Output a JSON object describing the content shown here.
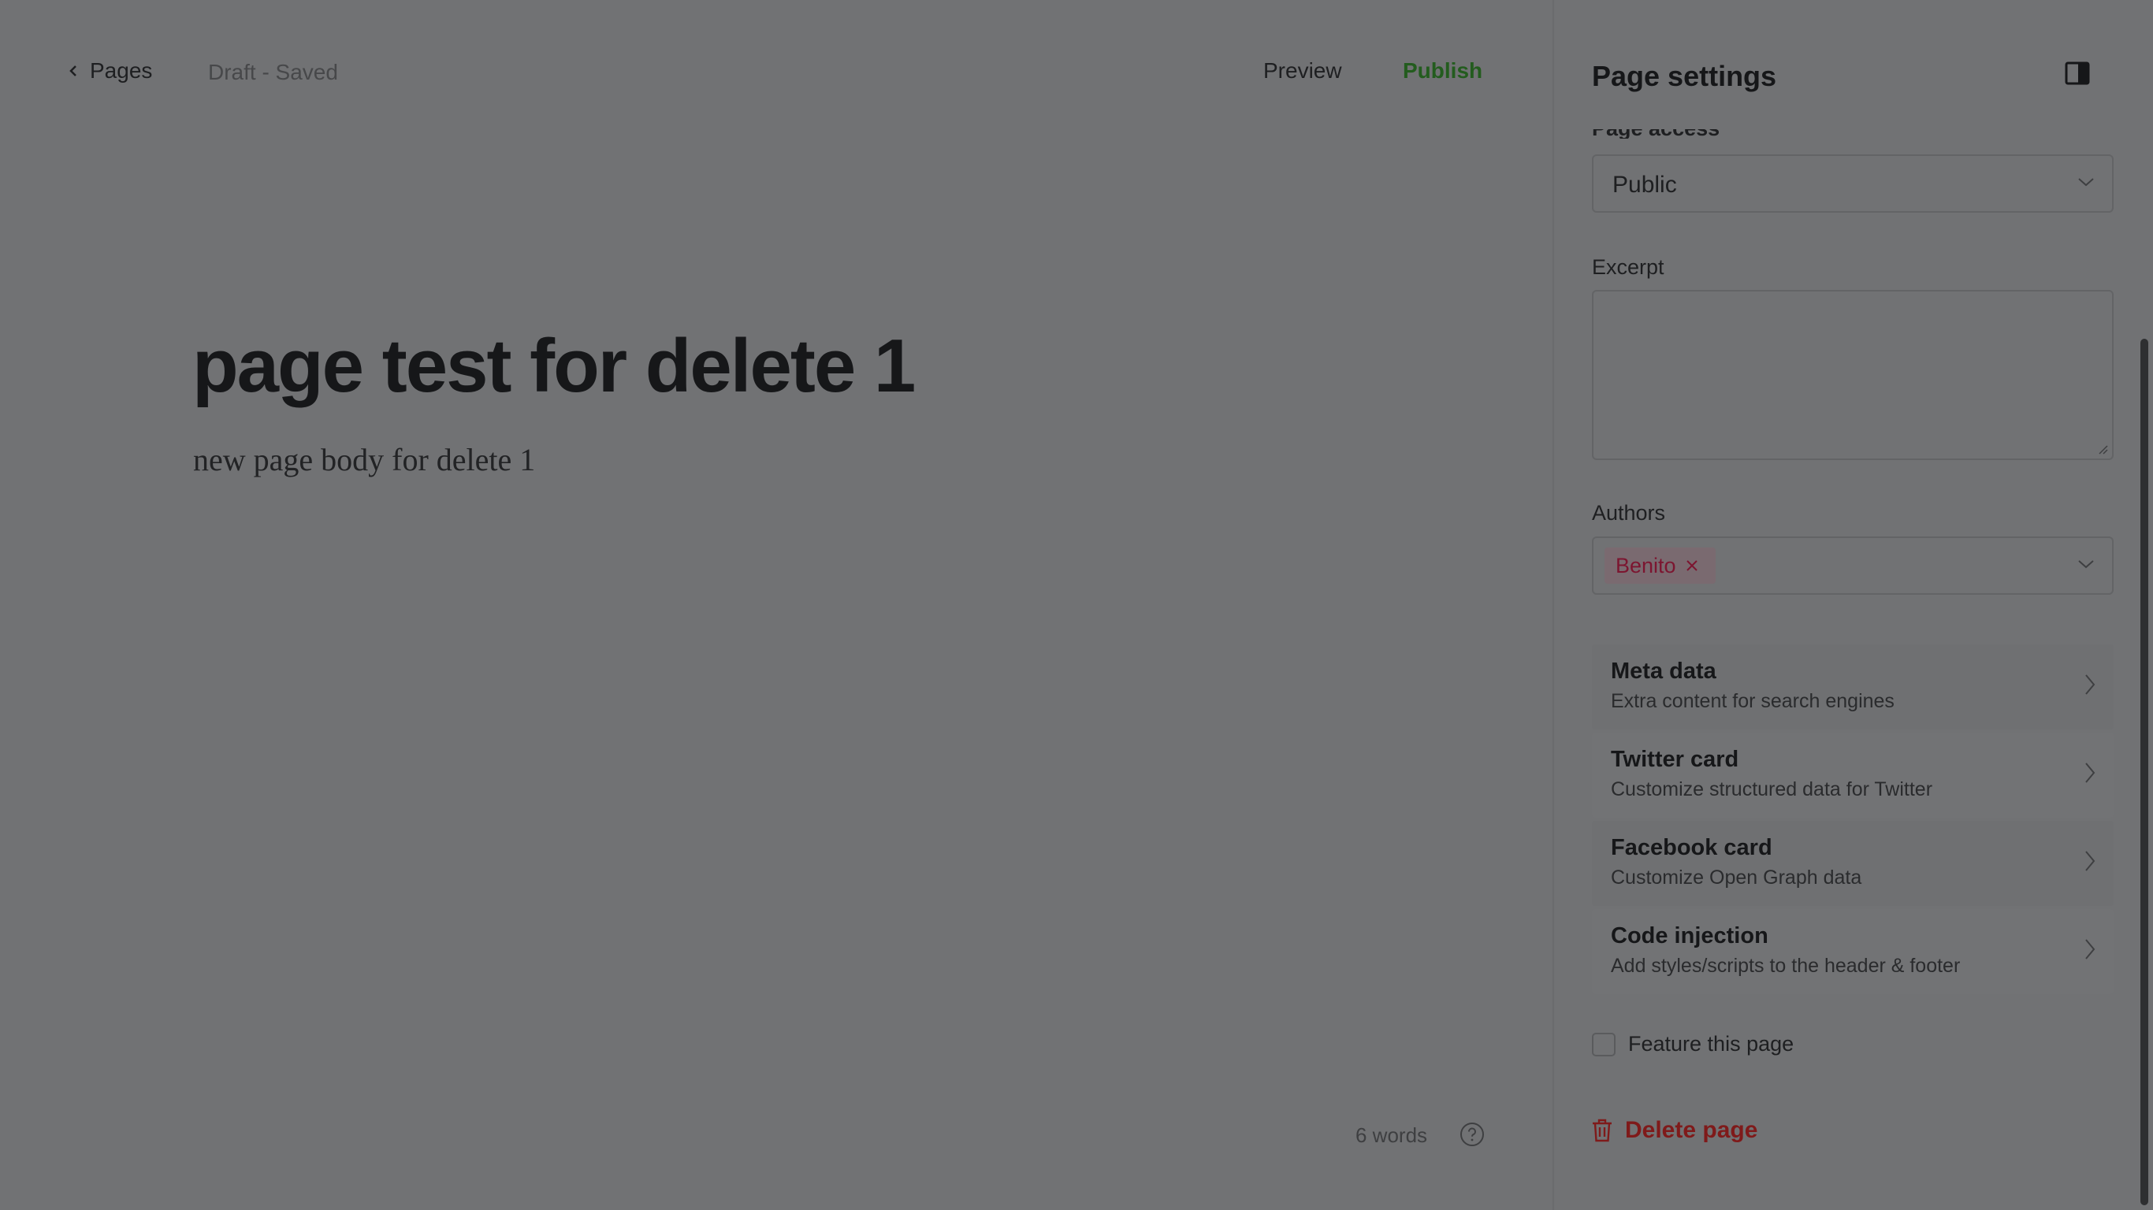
{
  "topbar": {
    "back_label": "Pages",
    "status": "Draft - Saved",
    "preview_label": "Preview",
    "publish_label": "Publish"
  },
  "editor": {
    "title": "page test for delete 1",
    "body": "new page body for delete 1",
    "word_count": "6 words"
  },
  "settings": {
    "heading": "Page settings",
    "page_access_label": "Page access",
    "page_access_value": "Public",
    "excerpt_label": "Excerpt",
    "excerpt_value": "",
    "authors_label": "Authors",
    "authors": [
      "Benito"
    ],
    "menu": [
      {
        "title": "Meta data",
        "subtitle": "Extra content for search engines"
      },
      {
        "title": "Twitter card",
        "subtitle": "Customize structured data for Twitter"
      },
      {
        "title": "Facebook card",
        "subtitle": "Customize Open Graph data"
      },
      {
        "title": "Code injection",
        "subtitle": "Add styles/scripts to the header & footer"
      }
    ],
    "feature_label": "Feature this page",
    "feature_checked": false,
    "delete_label": "Delete page"
  },
  "colors": {
    "overlay_bg": "#717274",
    "publish": "#235c1e",
    "delete": "#7f1a1a",
    "author_tag_text": "#7c1530"
  }
}
